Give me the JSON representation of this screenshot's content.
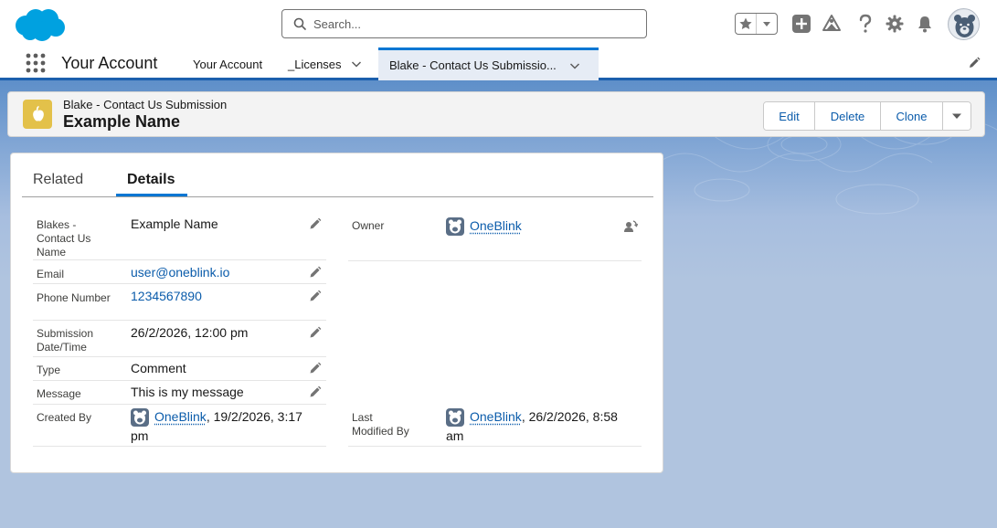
{
  "header": {
    "search_placeholder": "Search..."
  },
  "nav": {
    "app_name": "Your Account",
    "items": [
      {
        "label": "Your Account"
      },
      {
        "label": "_Licenses"
      },
      {
        "label": "Blake - Contact Us Submissio..."
      }
    ]
  },
  "record": {
    "object_type": "Blake - Contact Us Submission",
    "title": "Example Name",
    "actions": {
      "edit": "Edit",
      "delete": "Delete",
      "clone": "Clone"
    }
  },
  "tabs": {
    "related": "Related",
    "details": "Details"
  },
  "fields": {
    "name": {
      "label": "Blakes - Contact Us Name",
      "value": "Example Name"
    },
    "email": {
      "label": "Email",
      "value": "user@oneblink.io"
    },
    "phone": {
      "label": "Phone Number",
      "value": "1234567890"
    },
    "submission": {
      "label": "Submission Date/Time",
      "value": "26/2/2026, 12:00 pm"
    },
    "type": {
      "label": "Type",
      "value": "Comment"
    },
    "message": {
      "label": "Message",
      "value": "This is my message"
    },
    "created_by": {
      "label": "Created By",
      "user": "OneBlink",
      "date_line1": ", 19/2/2026, 3:17",
      "date_line2": "pm"
    },
    "owner": {
      "label": "Owner",
      "user": "OneBlink"
    },
    "last_modified": {
      "label_line1": "Last",
      "label_line2": "Modified By",
      "user": "OneBlink",
      "date_line1": ", 26/2/2026, 8:58",
      "date_line2": "am"
    }
  },
  "colors": {
    "brand": "#0176d3",
    "link": "#0b5cab",
    "object_icon": "#e3c14a"
  }
}
